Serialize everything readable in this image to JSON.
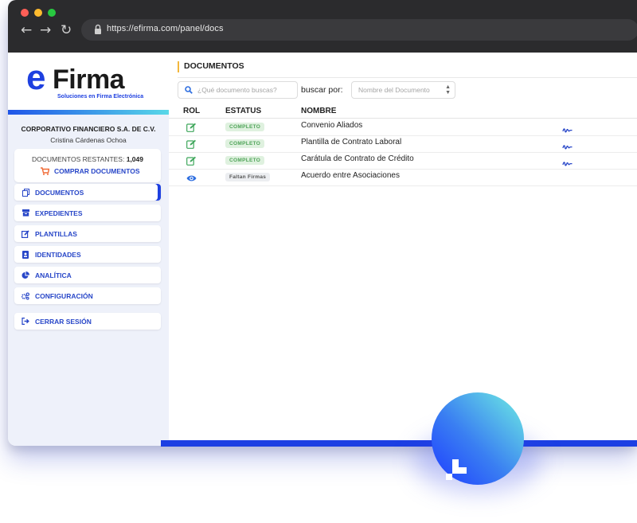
{
  "browser": {
    "url": "https://efirma.com/panel/docs",
    "nav": {
      "back": "←",
      "forward": "→",
      "reload": "↻"
    }
  },
  "logo": {
    "prefix": "e",
    "name": "Firma",
    "tagline": "Soluciones en Firma Electrónica"
  },
  "account": {
    "company": "CORPORATIVO FINANCIERO S.A. DE C.V.",
    "user": "Cristina Cárdenas Ochoa",
    "credits_label": "DOCUMENTOS RESTANTES:",
    "credits_value": "1,049",
    "buy_label": "COMPRAR DOCUMENTOS"
  },
  "menu": {
    "items": [
      {
        "label": "DOCUMENTOS",
        "icon": "documents-icon",
        "active": true
      },
      {
        "label": "EXPEDIENTES",
        "icon": "archive-icon"
      },
      {
        "label": "PLANTILLAS",
        "icon": "edit-icon"
      },
      {
        "label": "IDENTIDADES",
        "icon": "id-card-icon"
      },
      {
        "label": "ANALÍTICA",
        "icon": "pie-chart-icon"
      },
      {
        "label": "CONFIGURACIÓN",
        "icon": "cogs-icon"
      }
    ],
    "logout": "CERRAR SESIÓN"
  },
  "main": {
    "title": "DOCUMENTOS",
    "search_placeholder": "¿Qué documento buscas?",
    "search_by_label": "buscar por:",
    "search_by_value": "Nombre del Documento"
  },
  "table": {
    "headers": [
      "ROL",
      "ESTATUS",
      "NOMBRE"
    ],
    "rows": [
      {
        "rol": "edit-icon",
        "status": "COMPLETO",
        "name": "Convenio Aliados",
        "signed": true
      },
      {
        "rol": "edit-icon",
        "status": "COMPLETO",
        "name": "Plantilla de Contrato Laboral",
        "signed": true
      },
      {
        "rol": "edit-icon",
        "status": "COMPLETO",
        "name": "Carátula de Contrato de Crédito",
        "signed": true
      },
      {
        "rol": "eye-icon",
        "status": "Faltan Firmas",
        "name": "Acuerdo entre Asociaciones",
        "signed": false
      }
    ]
  },
  "colors": {
    "accent": "#1e40e0",
    "menu_text": "#2746c8",
    "status_complete_bg": "#dff1df",
    "status_complete_text": "#4fa458",
    "title_marker": "#f3b73c",
    "cart": "#f06a35"
  }
}
